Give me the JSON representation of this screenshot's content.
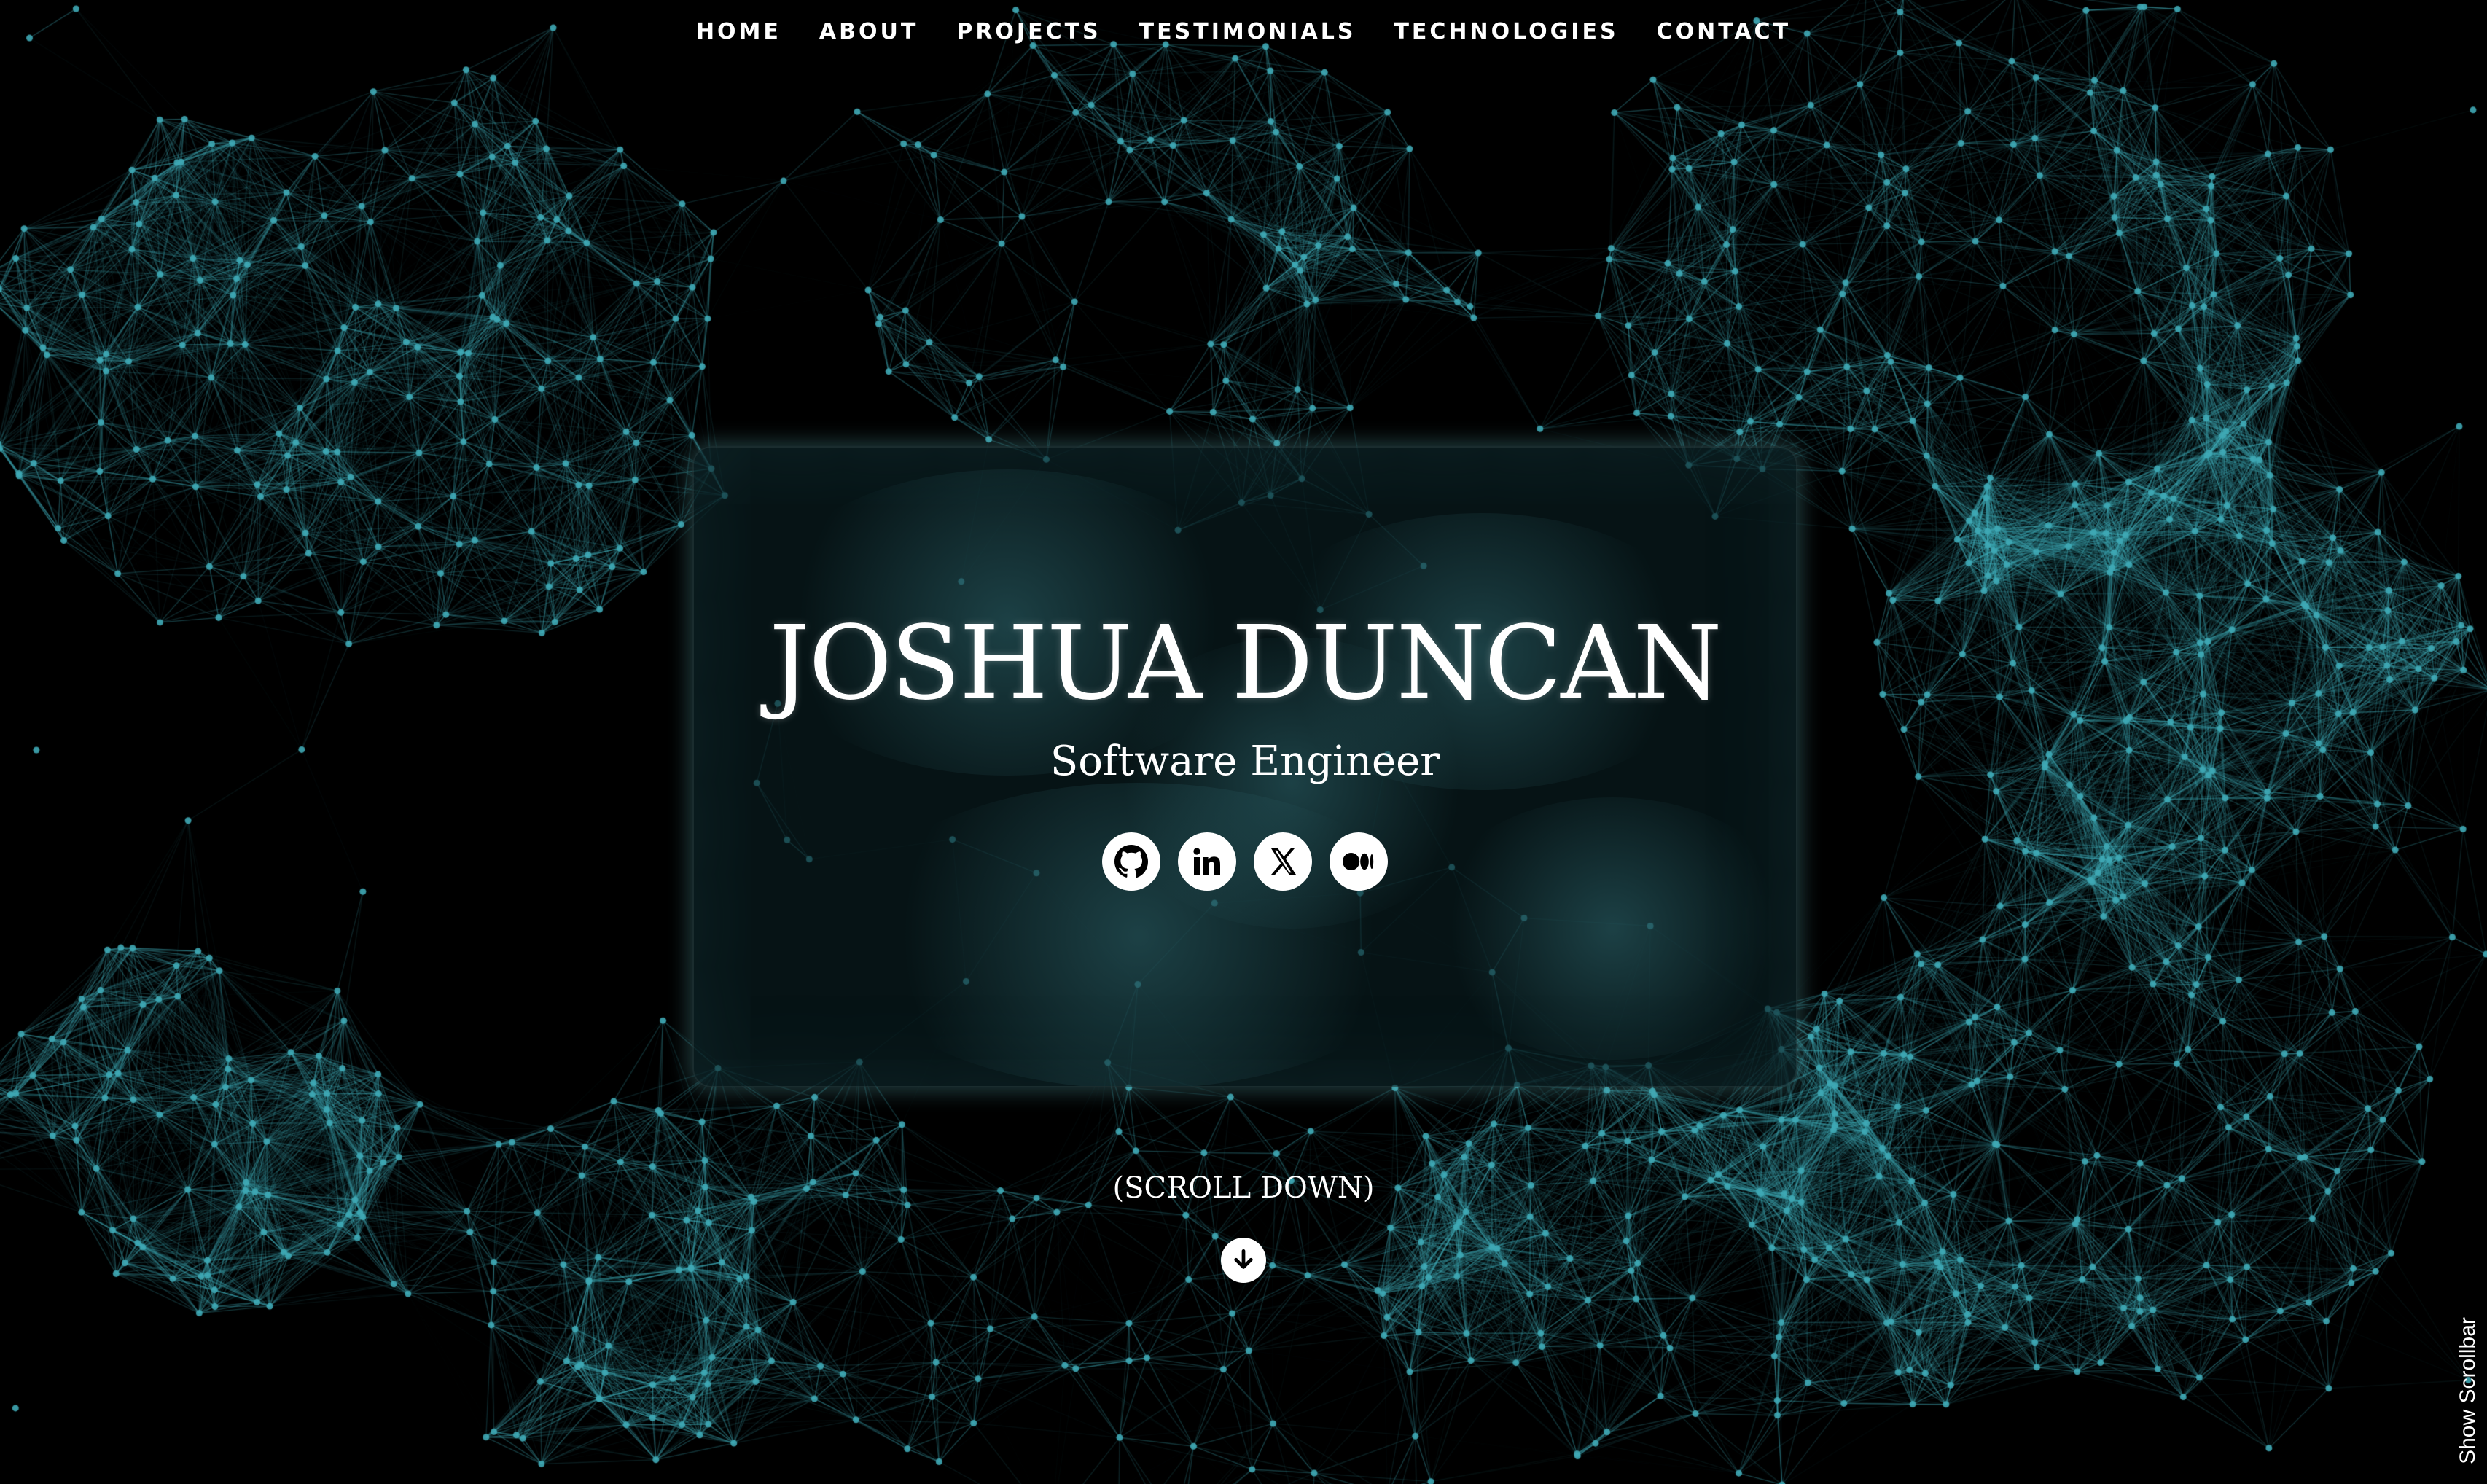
{
  "nav": {
    "items": [
      {
        "label": "HOME"
      },
      {
        "label": "ABOUT"
      },
      {
        "label": "PROJECTS"
      },
      {
        "label": "TESTIMONIALS"
      },
      {
        "label": "TECHNOLOGIES"
      },
      {
        "label": "CONTACT"
      }
    ]
  },
  "hero": {
    "name": "JOSHUA DUNCAN",
    "title": "Software Engineer",
    "socials": [
      {
        "icon": "github-icon"
      },
      {
        "icon": "linkedin-icon"
      },
      {
        "icon": "x-twitter-icon"
      },
      {
        "icon": "medium-icon"
      }
    ]
  },
  "scroll": {
    "label": "(SCROLL DOWN)",
    "icon": "arrow-down-icon"
  },
  "scrollbar_toggle": {
    "label": "Show Scrollbar"
  },
  "colors": {
    "background": "#000000",
    "network": "#3fa9b5",
    "text": "#ffffff"
  }
}
